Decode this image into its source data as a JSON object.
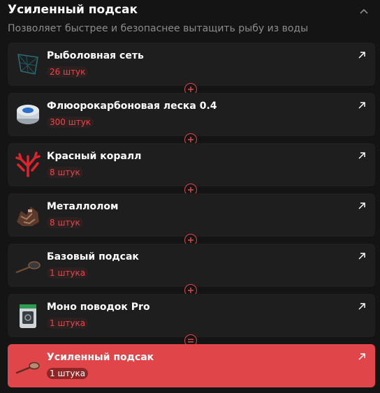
{
  "header": {
    "title": "Усиленный подсак",
    "subtitle": "Позволяет быстрее и безопаснее вытащить рыбу из воды"
  },
  "colors": {
    "accent": "#e04649",
    "card_bg": "#1e1e1e",
    "page_bg": "#141414"
  },
  "items": [
    {
      "name": "Рыболовная сеть",
      "qty": "26 штук",
      "icon": "fishing-net-icon"
    },
    {
      "name": "Флюорокарбоновая леска 0.4",
      "qty": "300 штук",
      "icon": "fishing-line-spool-icon"
    },
    {
      "name": "Красный коралл",
      "qty": "8 штук",
      "icon": "red-coral-icon"
    },
    {
      "name": "Металлолом",
      "qty": "8 штук",
      "icon": "scrap-metal-icon"
    },
    {
      "name": "Базовый подсак",
      "qty": "1 штука",
      "icon": "basic-landing-net-icon"
    },
    {
      "name": "Моно поводок Pro",
      "qty": "1 штука",
      "icon": "mono-leader-pack-icon"
    }
  ],
  "result": {
    "name": "Усиленный подсак",
    "qty": "1 штука",
    "icon": "reinforced-landing-net-icon"
  }
}
